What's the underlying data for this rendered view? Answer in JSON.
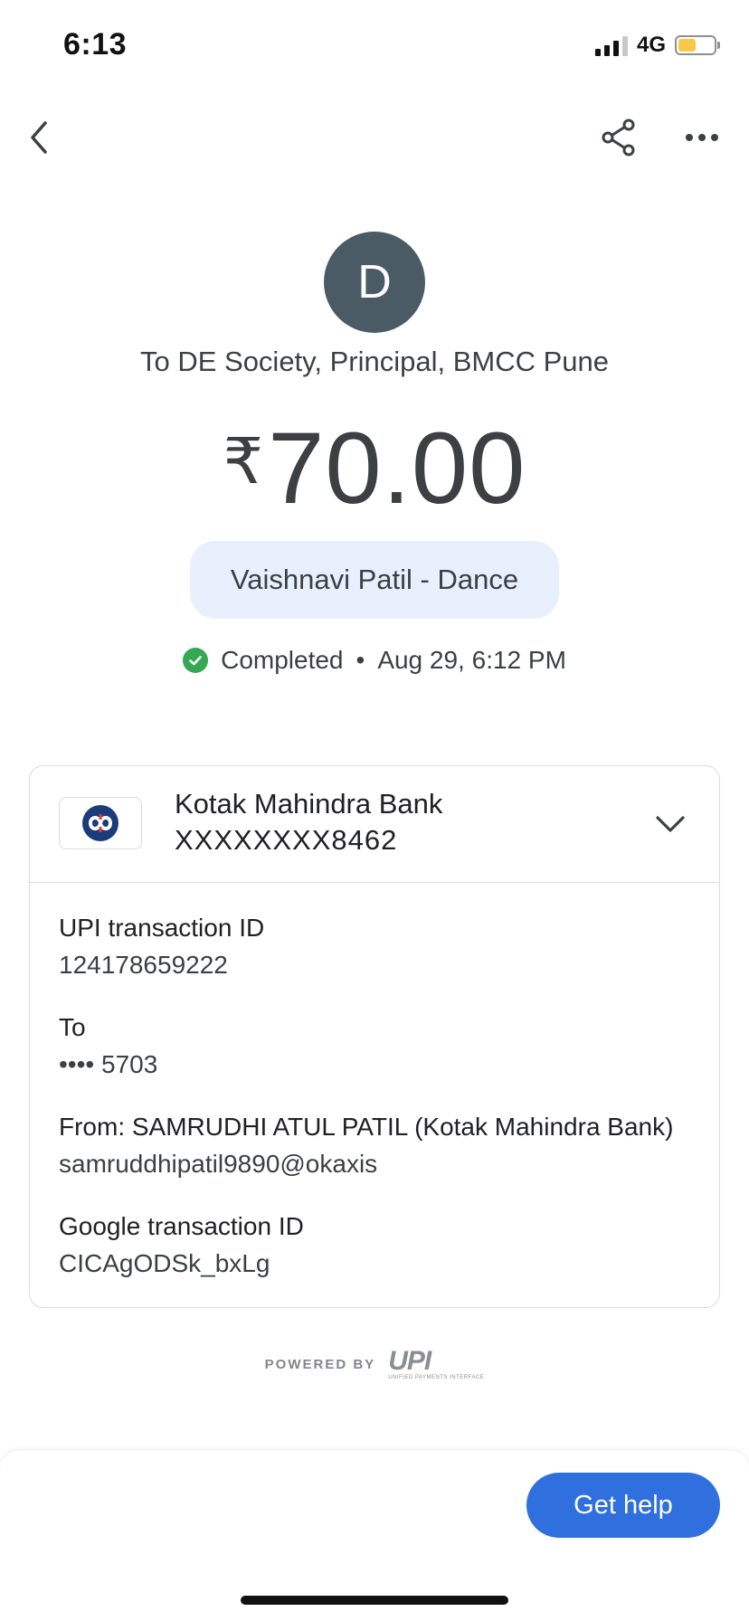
{
  "status_bar": {
    "time": "6:13",
    "network": "4G",
    "battery_level": 0.5
  },
  "app_bar": {
    "back_icon": "chevron-left-icon",
    "share_icon": "share-icon",
    "more_icon": "more-horizontal-icon"
  },
  "header": {
    "avatar_initial": "D",
    "recipient": "To DE Society, Principal, BMCC Pune",
    "currency_symbol": "₹",
    "amount": "70.00",
    "note": "Vaishnavi Patil - Dance",
    "status": "Completed",
    "separator": "•",
    "datetime": "Aug 29, 6:12 PM"
  },
  "card": {
    "bank_name": "Kotak Mahindra Bank",
    "bank_account": "XXXXXXXX8462",
    "details": [
      {
        "label": "UPI transaction ID",
        "value": "124178659222"
      },
      {
        "label": "To",
        "value": "•••• 5703"
      },
      {
        "label": "From: SAMRUDHI ATUL PATIL (Kotak Mahindra Bank)",
        "value": "samruddhipatil9890@okaxis"
      },
      {
        "label": "Google transaction ID",
        "value": "CICAgODSk_bxLg"
      }
    ]
  },
  "footer": {
    "powered_by": "POWERED BY",
    "upi_mark": "UPI",
    "upi_subtitle": "UNIFIED PAYMENTS INTERFACE",
    "help_label": "Get help"
  },
  "colors": {
    "accent": "#1a73e8",
    "avatar": "#4b5b66",
    "success": "#34a853",
    "pill": "#e8f0fe"
  }
}
